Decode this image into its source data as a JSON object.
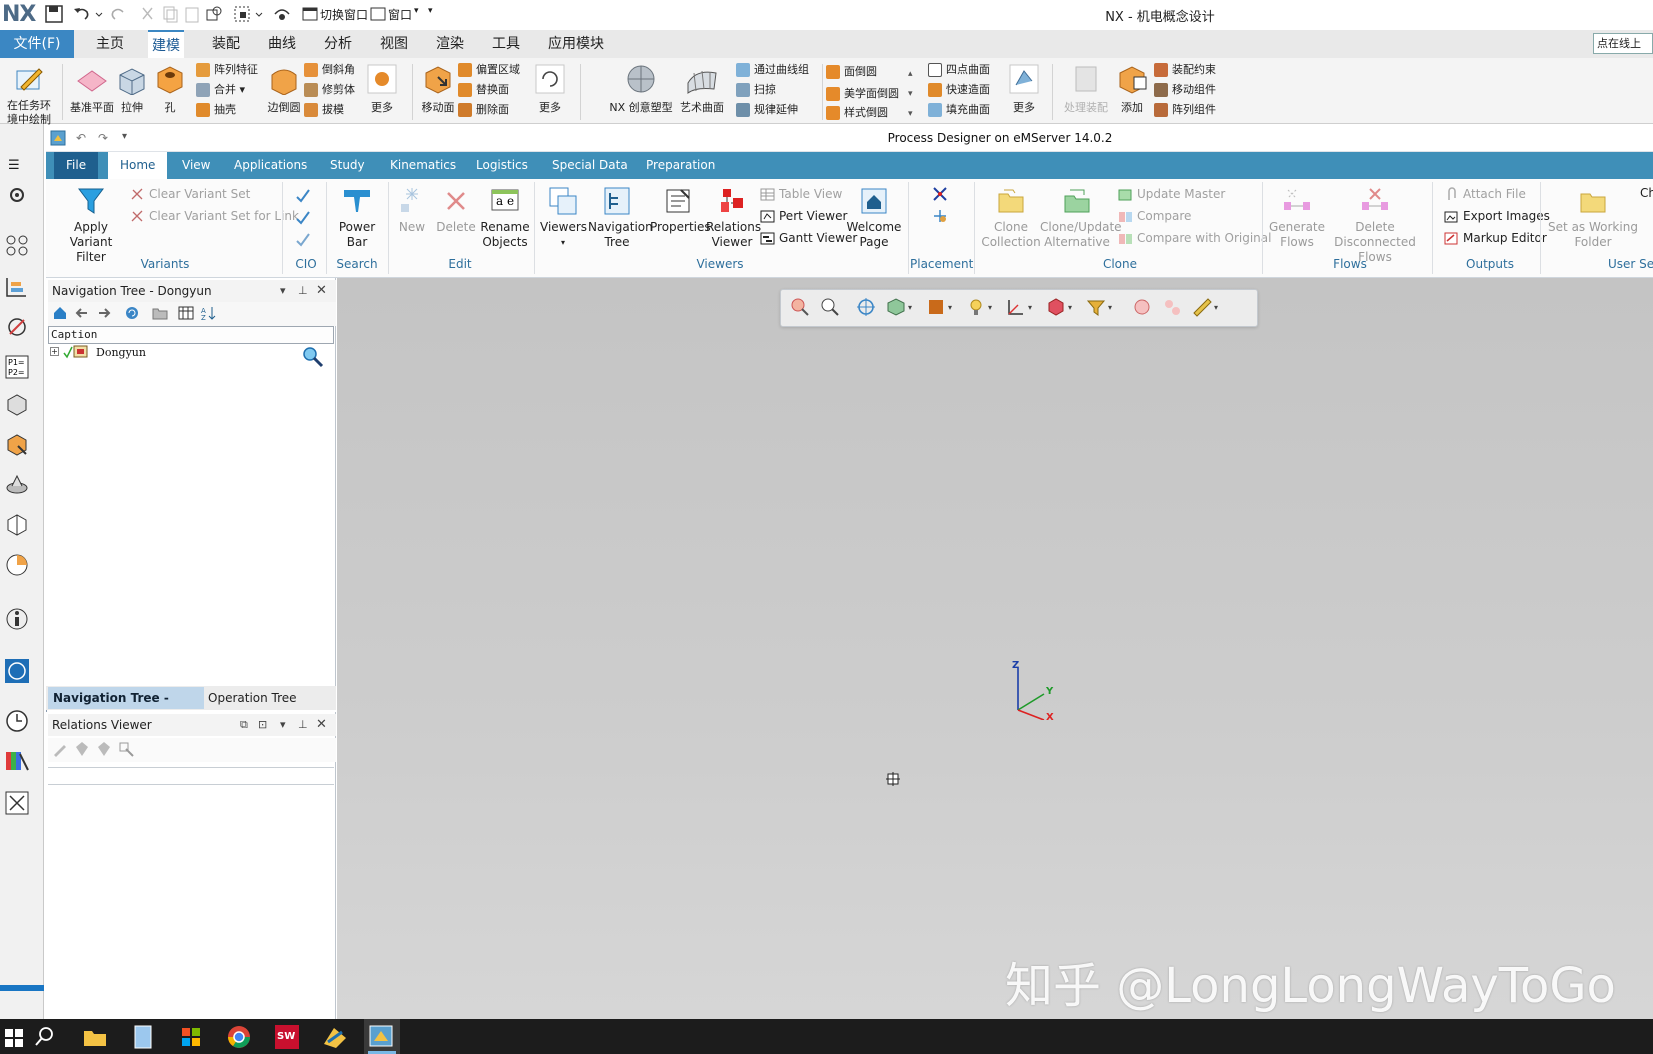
{
  "nx": {
    "logo": "NX",
    "title": "NX - 机电概念设计",
    "quick_access": {
      "switch_window": "切换窗口",
      "window": "窗口"
    },
    "menu": {
      "file": "文件(F)",
      "tabs": [
        "主页",
        "建模",
        "装配",
        "曲线",
        "分析",
        "视图",
        "渲染",
        "工具",
        "应用模块"
      ]
    },
    "search_placeholder": "点在线上",
    "ribbon": {
      "sketch_in_task": "在任务环境中绘制",
      "datum_plane": "基准平面",
      "extrude": "拉伸",
      "hole": "孔",
      "pattern_feature": "阵列特征",
      "unite": "合并",
      "shell": "抽壳",
      "edge_blend": "边倒圆",
      "chamfer": "倒斜角",
      "trim_body": "修剪体",
      "draft": "拔模",
      "more1": "更多",
      "move_face": "移动面",
      "offset_region": "偏置区域",
      "replace_face": "替换面",
      "delete_face": "删除面",
      "more2": "更多",
      "nx_realize_shape": "NX 创意塑型",
      "studio_surface": "艺术曲面",
      "through_curve_mesh": "通过曲线组",
      "sweep": "扫掠",
      "law_extension": "规律延伸",
      "face_blend": "面倒圆",
      "aesthetic_face_blend": "美学面倒圆",
      "styled_blend": "样式倒圆",
      "four_point_surface": "四点曲面",
      "rapid_surfacing": "快速造面",
      "fill_surface": "填充曲面",
      "more3": "更多",
      "process_assembly": "处理装配",
      "add": "添加",
      "assembly_constraints": "装配约束",
      "move_component": "移动组件",
      "pattern_component": "阵列组件"
    }
  },
  "pd": {
    "title": "Process Designer on eMServer 14.0.2",
    "tabs": [
      "File",
      "Home",
      "View",
      "Applications",
      "Study",
      "Kinematics",
      "Logistics",
      "Special Data",
      "Preparation"
    ],
    "ribbon": {
      "apply_variant_filter": "Apply Variant Filter",
      "clear_variant_set": "Clear Variant Set",
      "clear_variant_set_link": "Clear Variant Set for Link",
      "power_bar": "Power Bar",
      "new": "New",
      "delete": "Delete",
      "rename_objects": "Rename Objects",
      "viewers": "Viewers",
      "navigation_tree": "Navigation Tree",
      "properties": "Properties",
      "relations_viewer": "Relations Viewer",
      "table_view": "Table View",
      "pert_viewer": "Pert Viewer",
      "gantt_viewer": "Gantt Viewer",
      "welcome_page": "Welcome Page",
      "clone_collection": "Clone Collection",
      "clone_update_alt": "Clone/Update Alternative",
      "update_master": "Update Master",
      "compare": "Compare",
      "compare_original": "Compare with Original",
      "generate_flows": "Generate Flows",
      "delete_disconnected_flows": "Delete Disconnected Flows",
      "attach_file": "Attach File",
      "export_images": "Export Images",
      "markup_editor": "Markup Editor",
      "set_working_folder": "Set as Working Folder",
      "ch": "Ch"
    },
    "groups": {
      "variants": "Variants",
      "cio": "CIO",
      "search": "Search",
      "edit": "Edit",
      "viewers": "Viewers",
      "placement": "Placement",
      "clone": "Clone",
      "flows": "Flows",
      "outputs": "Outputs",
      "user_settings": "User Se"
    },
    "nav_panel": {
      "title": "Navigation Tree - Dongyun",
      "column": "Caption",
      "root": "Dongyun"
    },
    "bottom_tabs": {
      "active": "Navigation Tree - Dongyun",
      "other": "Operation Tree"
    },
    "relations_panel": {
      "title": "Relations Viewer"
    }
  },
  "watermark": "知乎 @LongLongWayToGo",
  "colors": {
    "nx_accent": "#3b87c3",
    "pd_tabbar": "#3f8fb8",
    "pd_file": "#1f5f8e",
    "taskbar": "#1c1c1c"
  }
}
